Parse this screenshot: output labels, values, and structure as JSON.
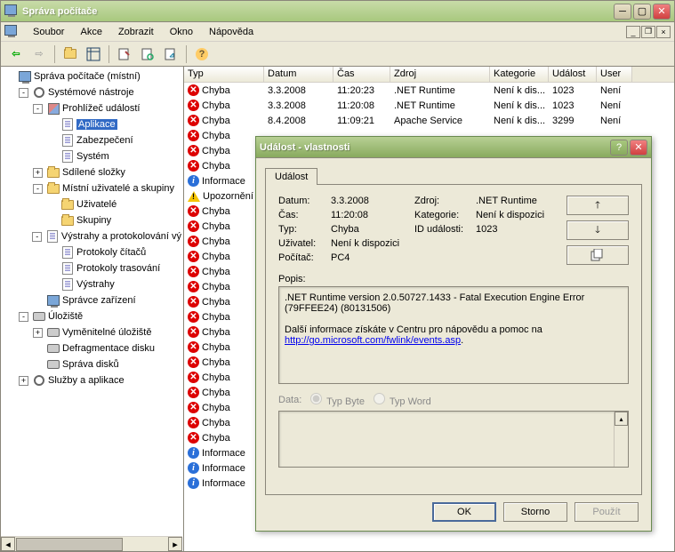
{
  "window": {
    "title": "Správa počítače"
  },
  "menubar": [
    "Soubor",
    "Akce",
    "Zobrazit",
    "Okno",
    "Nápověda"
  ],
  "tree": [
    {
      "level": 0,
      "toggle": "",
      "icon": "comp",
      "label": "Správa počítače (místní)"
    },
    {
      "level": 1,
      "toggle": "-",
      "icon": "tools",
      "label": "Systémové nástroje"
    },
    {
      "level": 2,
      "toggle": "-",
      "icon": "book",
      "label": "Prohlížeč událostí"
    },
    {
      "level": 3,
      "toggle": "",
      "icon": "doc",
      "label": "Aplikace",
      "active": true
    },
    {
      "level": 3,
      "toggle": "",
      "icon": "doc",
      "label": "Zabezpečení"
    },
    {
      "level": 3,
      "toggle": "",
      "icon": "doc",
      "label": "Systém"
    },
    {
      "level": 2,
      "toggle": "+",
      "icon": "folder",
      "label": "Sdílené složky"
    },
    {
      "level": 2,
      "toggle": "-",
      "icon": "folder",
      "label": "Místní uživatelé a skupiny"
    },
    {
      "level": 3,
      "toggle": "",
      "icon": "folder",
      "label": "Uživatelé"
    },
    {
      "level": 3,
      "toggle": "",
      "icon": "folder",
      "label": "Skupiny"
    },
    {
      "level": 2,
      "toggle": "-",
      "icon": "perf",
      "label": "Výstrahy a protokolování vý"
    },
    {
      "level": 3,
      "toggle": "",
      "icon": "perf",
      "label": "Protokoly čítačů"
    },
    {
      "level": 3,
      "toggle": "",
      "icon": "perf",
      "label": "Protokoly trasování"
    },
    {
      "level": 3,
      "toggle": "",
      "icon": "perf",
      "label": "Výstrahy"
    },
    {
      "level": 2,
      "toggle": "",
      "icon": "comp",
      "label": "Správce zařízení"
    },
    {
      "level": 1,
      "toggle": "-",
      "icon": "disk",
      "label": "Úložiště"
    },
    {
      "level": 2,
      "toggle": "+",
      "icon": "disk",
      "label": "Vyměnitelné úložiště"
    },
    {
      "level": 2,
      "toggle": "",
      "icon": "disk",
      "label": "Defragmentace disku"
    },
    {
      "level": 2,
      "toggle": "",
      "icon": "disk",
      "label": "Správa disků"
    },
    {
      "level": 1,
      "toggle": "+",
      "icon": "gear",
      "label": "Služby a aplikace"
    }
  ],
  "list": {
    "headers": [
      "Typ",
      "Datum",
      "Čas",
      "Zdroj",
      "Kategorie",
      "Událost",
      "User"
    ],
    "rows": [
      {
        "icon": "error",
        "typ": "Chyba",
        "datum": "3.3.2008",
        "cas": "11:20:23",
        "zdroj": ".NET Runtime",
        "kat": "Není k dis...",
        "ud": "1023",
        "user": "Není"
      },
      {
        "icon": "error",
        "typ": "Chyba",
        "datum": "3.3.2008",
        "cas": "11:20:08",
        "zdroj": ".NET Runtime",
        "kat": "Není k dis...",
        "ud": "1023",
        "user": "Není"
      },
      {
        "icon": "error",
        "typ": "Chyba",
        "datum": "8.4.2008",
        "cas": "11:09:21",
        "zdroj": "Apache Service",
        "kat": "Není k dis...",
        "ud": "3299",
        "user": "Není"
      },
      {
        "icon": "error",
        "typ": "Chyba"
      },
      {
        "icon": "error",
        "typ": "Chyba"
      },
      {
        "icon": "error",
        "typ": "Chyba"
      },
      {
        "icon": "info",
        "typ": "Informace"
      },
      {
        "icon": "warn",
        "typ": "Upozornění"
      },
      {
        "icon": "error",
        "typ": "Chyba"
      },
      {
        "icon": "error",
        "typ": "Chyba"
      },
      {
        "icon": "error",
        "typ": "Chyba"
      },
      {
        "icon": "error",
        "typ": "Chyba"
      },
      {
        "icon": "error",
        "typ": "Chyba"
      },
      {
        "icon": "error",
        "typ": "Chyba"
      },
      {
        "icon": "error",
        "typ": "Chyba"
      },
      {
        "icon": "error",
        "typ": "Chyba"
      },
      {
        "icon": "error",
        "typ": "Chyba"
      },
      {
        "icon": "error",
        "typ": "Chyba"
      },
      {
        "icon": "error",
        "typ": "Chyba"
      },
      {
        "icon": "error",
        "typ": "Chyba"
      },
      {
        "icon": "error",
        "typ": "Chyba"
      },
      {
        "icon": "error",
        "typ": "Chyba"
      },
      {
        "icon": "error",
        "typ": "Chyba"
      },
      {
        "icon": "error",
        "typ": "Chyba"
      },
      {
        "icon": "info",
        "typ": "Informace"
      },
      {
        "icon": "info",
        "typ": "Informace"
      },
      {
        "icon": "info",
        "typ": "Informace"
      }
    ]
  },
  "dialog": {
    "title": "Událost - vlastnosti",
    "tab": "Událost",
    "labels": {
      "datum": "Datum:",
      "cas": "Čas:",
      "typ": "Typ:",
      "uzivatel": "Uživatel:",
      "pocitac": "Počítač:",
      "zdroj": "Zdroj:",
      "kategorie": "Kategorie:",
      "idud": "ID události:",
      "popis": "Popis:",
      "data": "Data:",
      "typbyte": "Typ Byte",
      "typword": "Typ Word"
    },
    "values": {
      "datum": "3.3.2008",
      "cas": "11:20:08",
      "typ": "Chyba",
      "uzivatel": "Není k dispozici",
      "pocitac": "PC4",
      "zdroj": ".NET Runtime",
      "kategorie": "Není k dispozici",
      "idud": "1023"
    },
    "desc": {
      "line1": ".NET Runtime version 2.0.50727.1433 - Fatal Execution Engine Error (79FFEE24) (80131506)",
      "line2": "Další informace získáte v Centru pro nápovědu a pomoc na ",
      "link": "http://go.microsoft.com/fwlink/events.asp"
    },
    "buttons": {
      "ok": "OK",
      "storno": "Storno",
      "pouzit": "Použít"
    }
  }
}
